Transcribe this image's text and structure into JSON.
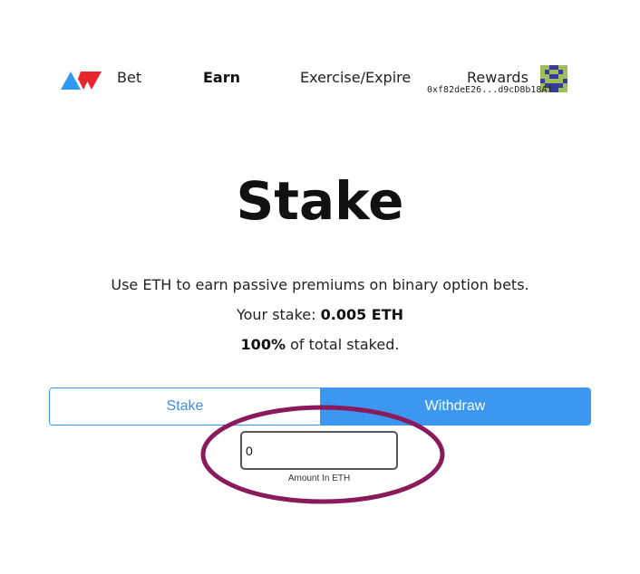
{
  "nav": {
    "logo_icon": "av-logo-triangles-icon",
    "items": [
      {
        "label": "Bet",
        "active": false
      },
      {
        "label": "Earn",
        "active": true
      },
      {
        "label": "Exercise/Expire",
        "active": false
      },
      {
        "label": "Rewards",
        "active": false
      }
    ],
    "avatar_icon": "identicon-avatar-icon",
    "wallet_address": "0xf82deE26...d9cD8b18Af"
  },
  "main": {
    "title": "Stake",
    "description": "Use ETH to earn passive premiums on binary option bets.",
    "stake_prefix": "Your stake: ",
    "stake_value": "0.005 ETH",
    "share_value": "100%",
    "share_suffix": " of total staked."
  },
  "tabs": [
    {
      "label": "Stake",
      "selected": false
    },
    {
      "label": "Withdraw",
      "selected": true
    }
  ],
  "amount": {
    "value": "0",
    "label": "Amount In ETH"
  },
  "annotation": {
    "type": "ellipse-highlight",
    "color": "#8b1a5c"
  },
  "colors": {
    "accent": "#3b97f0",
    "logo_blue": "#2f9bf0",
    "logo_red": "#e8262d"
  }
}
